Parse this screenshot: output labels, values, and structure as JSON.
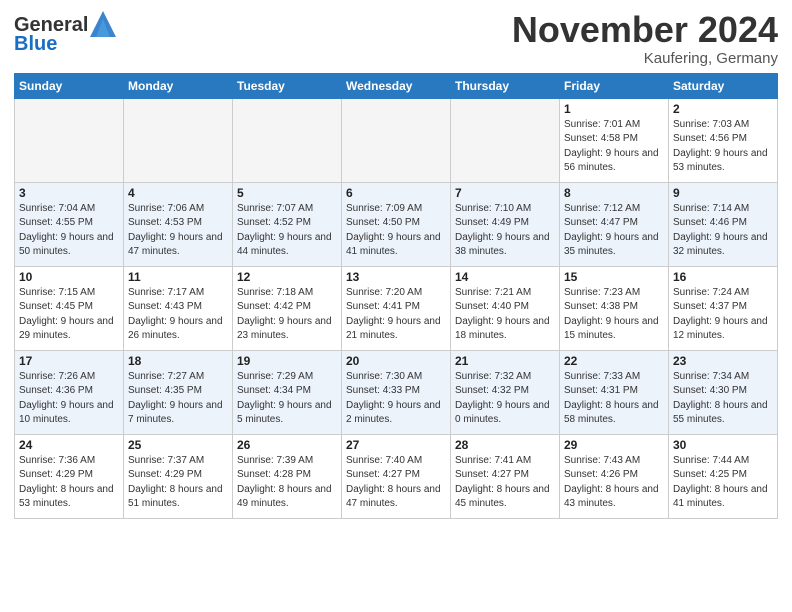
{
  "header": {
    "logo_general": "General",
    "logo_blue": "Blue",
    "month_title": "November 2024",
    "location": "Kaufering, Germany"
  },
  "days_of_week": [
    "Sunday",
    "Monday",
    "Tuesday",
    "Wednesday",
    "Thursday",
    "Friday",
    "Saturday"
  ],
  "weeks": [
    [
      {
        "day": "",
        "info": ""
      },
      {
        "day": "",
        "info": ""
      },
      {
        "day": "",
        "info": ""
      },
      {
        "day": "",
        "info": ""
      },
      {
        "day": "",
        "info": ""
      },
      {
        "day": "1",
        "info": "Sunrise: 7:01 AM\nSunset: 4:58 PM\nDaylight: 9 hours and 56 minutes."
      },
      {
        "day": "2",
        "info": "Sunrise: 7:03 AM\nSunset: 4:56 PM\nDaylight: 9 hours and 53 minutes."
      }
    ],
    [
      {
        "day": "3",
        "info": "Sunrise: 7:04 AM\nSunset: 4:55 PM\nDaylight: 9 hours and 50 minutes."
      },
      {
        "day": "4",
        "info": "Sunrise: 7:06 AM\nSunset: 4:53 PM\nDaylight: 9 hours and 47 minutes."
      },
      {
        "day": "5",
        "info": "Sunrise: 7:07 AM\nSunset: 4:52 PM\nDaylight: 9 hours and 44 minutes."
      },
      {
        "day": "6",
        "info": "Sunrise: 7:09 AM\nSunset: 4:50 PM\nDaylight: 9 hours and 41 minutes."
      },
      {
        "day": "7",
        "info": "Sunrise: 7:10 AM\nSunset: 4:49 PM\nDaylight: 9 hours and 38 minutes."
      },
      {
        "day": "8",
        "info": "Sunrise: 7:12 AM\nSunset: 4:47 PM\nDaylight: 9 hours and 35 minutes."
      },
      {
        "day": "9",
        "info": "Sunrise: 7:14 AM\nSunset: 4:46 PM\nDaylight: 9 hours and 32 minutes."
      }
    ],
    [
      {
        "day": "10",
        "info": "Sunrise: 7:15 AM\nSunset: 4:45 PM\nDaylight: 9 hours and 29 minutes."
      },
      {
        "day": "11",
        "info": "Sunrise: 7:17 AM\nSunset: 4:43 PM\nDaylight: 9 hours and 26 minutes."
      },
      {
        "day": "12",
        "info": "Sunrise: 7:18 AM\nSunset: 4:42 PM\nDaylight: 9 hours and 23 minutes."
      },
      {
        "day": "13",
        "info": "Sunrise: 7:20 AM\nSunset: 4:41 PM\nDaylight: 9 hours and 21 minutes."
      },
      {
        "day": "14",
        "info": "Sunrise: 7:21 AM\nSunset: 4:40 PM\nDaylight: 9 hours and 18 minutes."
      },
      {
        "day": "15",
        "info": "Sunrise: 7:23 AM\nSunset: 4:38 PM\nDaylight: 9 hours and 15 minutes."
      },
      {
        "day": "16",
        "info": "Sunrise: 7:24 AM\nSunset: 4:37 PM\nDaylight: 9 hours and 12 minutes."
      }
    ],
    [
      {
        "day": "17",
        "info": "Sunrise: 7:26 AM\nSunset: 4:36 PM\nDaylight: 9 hours and 10 minutes."
      },
      {
        "day": "18",
        "info": "Sunrise: 7:27 AM\nSunset: 4:35 PM\nDaylight: 9 hours and 7 minutes."
      },
      {
        "day": "19",
        "info": "Sunrise: 7:29 AM\nSunset: 4:34 PM\nDaylight: 9 hours and 5 minutes."
      },
      {
        "day": "20",
        "info": "Sunrise: 7:30 AM\nSunset: 4:33 PM\nDaylight: 9 hours and 2 minutes."
      },
      {
        "day": "21",
        "info": "Sunrise: 7:32 AM\nSunset: 4:32 PM\nDaylight: 9 hours and 0 minutes."
      },
      {
        "day": "22",
        "info": "Sunrise: 7:33 AM\nSunset: 4:31 PM\nDaylight: 8 hours and 58 minutes."
      },
      {
        "day": "23",
        "info": "Sunrise: 7:34 AM\nSunset: 4:30 PM\nDaylight: 8 hours and 55 minutes."
      }
    ],
    [
      {
        "day": "24",
        "info": "Sunrise: 7:36 AM\nSunset: 4:29 PM\nDaylight: 8 hours and 53 minutes."
      },
      {
        "day": "25",
        "info": "Sunrise: 7:37 AM\nSunset: 4:29 PM\nDaylight: 8 hours and 51 minutes."
      },
      {
        "day": "26",
        "info": "Sunrise: 7:39 AM\nSunset: 4:28 PM\nDaylight: 8 hours and 49 minutes."
      },
      {
        "day": "27",
        "info": "Sunrise: 7:40 AM\nSunset: 4:27 PM\nDaylight: 8 hours and 47 minutes."
      },
      {
        "day": "28",
        "info": "Sunrise: 7:41 AM\nSunset: 4:27 PM\nDaylight: 8 hours and 45 minutes."
      },
      {
        "day": "29",
        "info": "Sunrise: 7:43 AM\nSunset: 4:26 PM\nDaylight: 8 hours and 43 minutes."
      },
      {
        "day": "30",
        "info": "Sunrise: 7:44 AM\nSunset: 4:25 PM\nDaylight: 8 hours and 41 minutes."
      }
    ]
  ]
}
